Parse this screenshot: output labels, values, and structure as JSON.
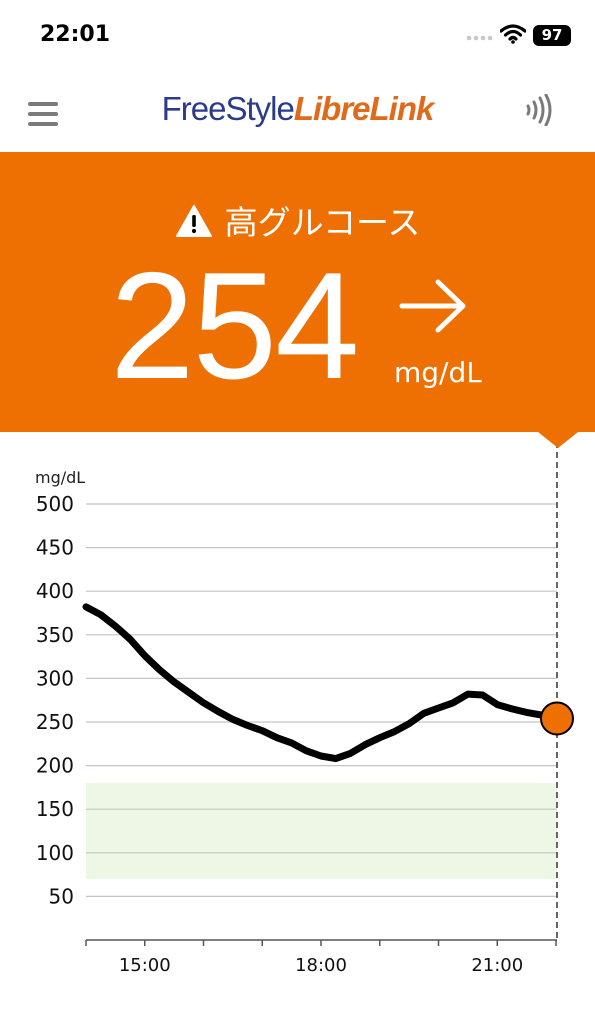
{
  "status_bar": {
    "time": "22:01",
    "battery": "97"
  },
  "header": {
    "logo_part1": "FreeStyle",
    "logo_part2": "LibreLink",
    "menu_icon": "hamburger-menu-icon",
    "scan_icon": "nfc-scan-icon"
  },
  "alert": {
    "icon": "warning-triangle-icon",
    "text": "高グルコース",
    "value": "254",
    "unit": "mg/dL",
    "trend": "right-arrow-icon",
    "background_color": "#ef7002"
  },
  "chart_data": {
    "type": "line",
    "ylabel": "mg/dL",
    "ylim": [
      0,
      500
    ],
    "yticks": [
      500,
      450,
      400,
      350,
      300,
      250,
      200,
      150,
      100,
      50
    ],
    "xticks": [
      "15:00",
      "18:00",
      "21:00"
    ],
    "xlim": [
      "14:00",
      "22:01"
    ],
    "target_range": [
      70,
      180
    ],
    "target_range_color": "#eef6e5",
    "grid": true,
    "current_value": 254,
    "current_marker_color": "#ef7002",
    "line_color": "#000000",
    "series": [
      {
        "x": [
          "14:00",
          "14:15",
          "14:30",
          "14:45",
          "15:00",
          "15:15",
          "15:30",
          "15:45",
          "16:00",
          "16:15",
          "16:30",
          "16:45",
          "17:00",
          "17:15",
          "17:30",
          "17:45",
          "18:00",
          "18:15",
          "18:30",
          "18:45",
          "19:00",
          "19:15",
          "19:30",
          "19:45",
          "20:00",
          "20:15",
          "20:30",
          "20:45",
          "21:00",
          "21:15",
          "21:30",
          "21:45",
          "22:01"
        ],
        "values": [
          382,
          373,
          360,
          345,
          326,
          310,
          296,
          284,
          272,
          262,
          253,
          246,
          240,
          232,
          226,
          217,
          211,
          208,
          214,
          224,
          232,
          239,
          248,
          260,
          266,
          272,
          282,
          281,
          270,
          265,
          261,
          258,
          254
        ]
      }
    ]
  }
}
